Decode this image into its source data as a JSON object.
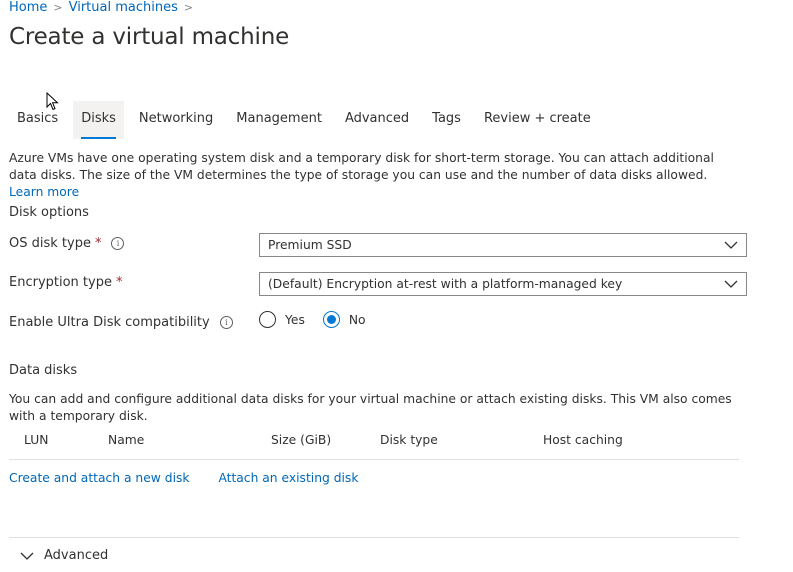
{
  "breadcrumb": {
    "home": "Home",
    "vms": "Virtual machines"
  },
  "page_title": "Create a virtual machine",
  "tabs": [
    {
      "label": "Basics",
      "active": false
    },
    {
      "label": "Disks",
      "active": true
    },
    {
      "label": "Networking",
      "active": false
    },
    {
      "label": "Management",
      "active": false
    },
    {
      "label": "Advanced",
      "active": false
    },
    {
      "label": "Tags",
      "active": false
    },
    {
      "label": "Review + create",
      "active": false
    }
  ],
  "intro": {
    "text": "Azure VMs have one operating system disk and a temporary disk for short-term storage. You can attach additional data disks. The size of the VM determines the type of storage you can use and the number of data disks allowed.",
    "learn_more": "Learn more"
  },
  "disk_options": {
    "title": "Disk options",
    "os_disk_type": {
      "label": "OS disk type",
      "required": "*",
      "value": "Premium SSD"
    },
    "encryption_type": {
      "label": "Encryption type",
      "required": "*",
      "value": "(Default) Encryption at-rest with a platform-managed key"
    },
    "ultra_disk": {
      "label": "Enable Ultra Disk compatibility",
      "options": [
        "Yes",
        "No"
      ],
      "selected": "No"
    }
  },
  "data_disks": {
    "title": "Data disks",
    "description": "You can add and configure additional data disks for your virtual machine or attach existing disks. This VM also comes with a temporary disk.",
    "columns": [
      "LUN",
      "Name",
      "Size (GiB)",
      "Disk type",
      "Host caching"
    ],
    "create_link": "Create and attach a new disk",
    "attach_link": "Attach an existing disk"
  },
  "advanced_section": {
    "label": "Advanced",
    "expanded": false
  },
  "icons": {
    "info": "info-icon",
    "chevron": "chevron-down-icon"
  },
  "colors": {
    "accent": "#0078d4",
    "link": "#0067b8",
    "required": "#a4262c"
  }
}
